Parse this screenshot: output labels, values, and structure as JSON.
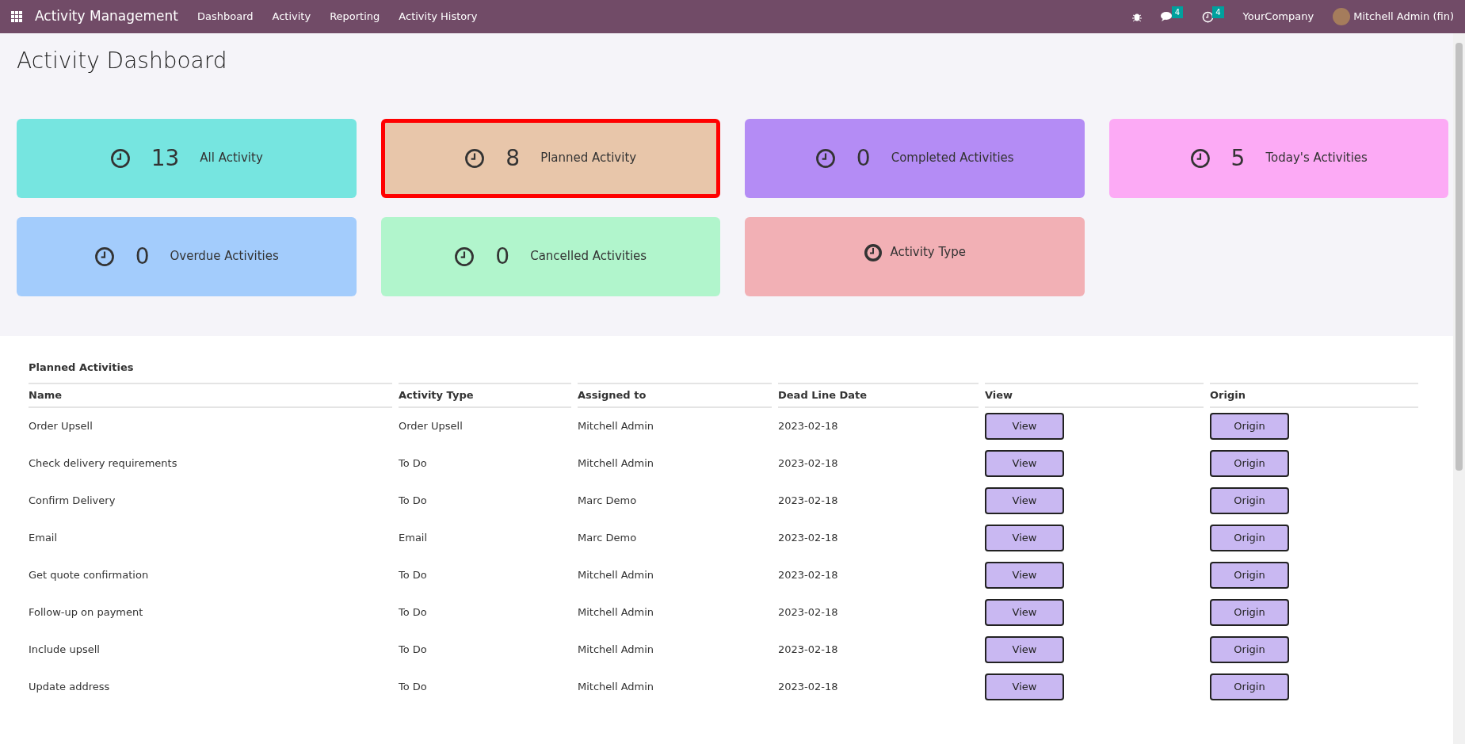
{
  "navbar": {
    "app_name": "Activity Management",
    "menu": [
      "Dashboard",
      "Activity",
      "Reporting",
      "Activity History"
    ],
    "messages_count": "4",
    "activities_count": "4",
    "company": "YourCompany",
    "user": "Mitchell Admin (fin)"
  },
  "page_title": "Activity Dashboard",
  "cards": [
    {
      "kind": "count",
      "count": "13",
      "label": "All Activity",
      "color": "#76e5e0",
      "selected": false
    },
    {
      "kind": "count",
      "count": "8",
      "label": "Planned Activity",
      "color": "#e8c6aa",
      "selected": true
    },
    {
      "kind": "count",
      "count": "0",
      "label": "Completed Activities",
      "color": "#b48cf5",
      "selected": false
    },
    {
      "kind": "count",
      "count": "5",
      "label": "Today's Activities",
      "color": "#fcaaf5",
      "selected": false
    },
    {
      "kind": "count",
      "count": "0",
      "label": "Overdue Activities",
      "color": "#a3ccfc",
      "selected": false
    },
    {
      "kind": "count",
      "count": "0",
      "label": "Cancelled Activities",
      "color": "#b1f5cc",
      "selected": false
    },
    {
      "kind": "link",
      "label": "Activity Type",
      "color": "#f2b0b5",
      "selected": false
    }
  ],
  "table": {
    "title": "Planned Activities",
    "columns": [
      "Name",
      "Activity Type",
      "Assigned to",
      "Dead Line Date",
      "View",
      "Origin"
    ],
    "rows": [
      {
        "name": "Order Upsell",
        "activity_type": "Order Upsell",
        "assigned_to": "Mitchell Admin",
        "deadline": "2023-02-18",
        "view": "View",
        "origin": "Origin"
      },
      {
        "name": "Check delivery requirements",
        "activity_type": "To Do",
        "assigned_to": "Mitchell Admin",
        "deadline": "2023-02-18",
        "view": "View",
        "origin": "Origin"
      },
      {
        "name": "Confirm Delivery",
        "activity_type": "To Do",
        "assigned_to": "Marc Demo",
        "deadline": "2023-02-18",
        "view": "View",
        "origin": "Origin"
      },
      {
        "name": "Email",
        "activity_type": "Email",
        "assigned_to": "Marc Demo",
        "deadline": "2023-02-18",
        "view": "View",
        "origin": "Origin"
      },
      {
        "name": "Get quote confirmation",
        "activity_type": "To Do",
        "assigned_to": "Mitchell Admin",
        "deadline": "2023-02-18",
        "view": "View",
        "origin": "Origin"
      },
      {
        "name": "Follow-up on payment",
        "activity_type": "To Do",
        "assigned_to": "Mitchell Admin",
        "deadline": "2023-02-18",
        "view": "View",
        "origin": "Origin"
      },
      {
        "name": "Include upsell",
        "activity_type": "To Do",
        "assigned_to": "Mitchell Admin",
        "deadline": "2023-02-18",
        "view": "View",
        "origin": "Origin"
      },
      {
        "name": "Update address",
        "activity_type": "To Do",
        "assigned_to": "Mitchell Admin",
        "deadline": "2023-02-18",
        "view": "View",
        "origin": "Origin"
      }
    ]
  }
}
